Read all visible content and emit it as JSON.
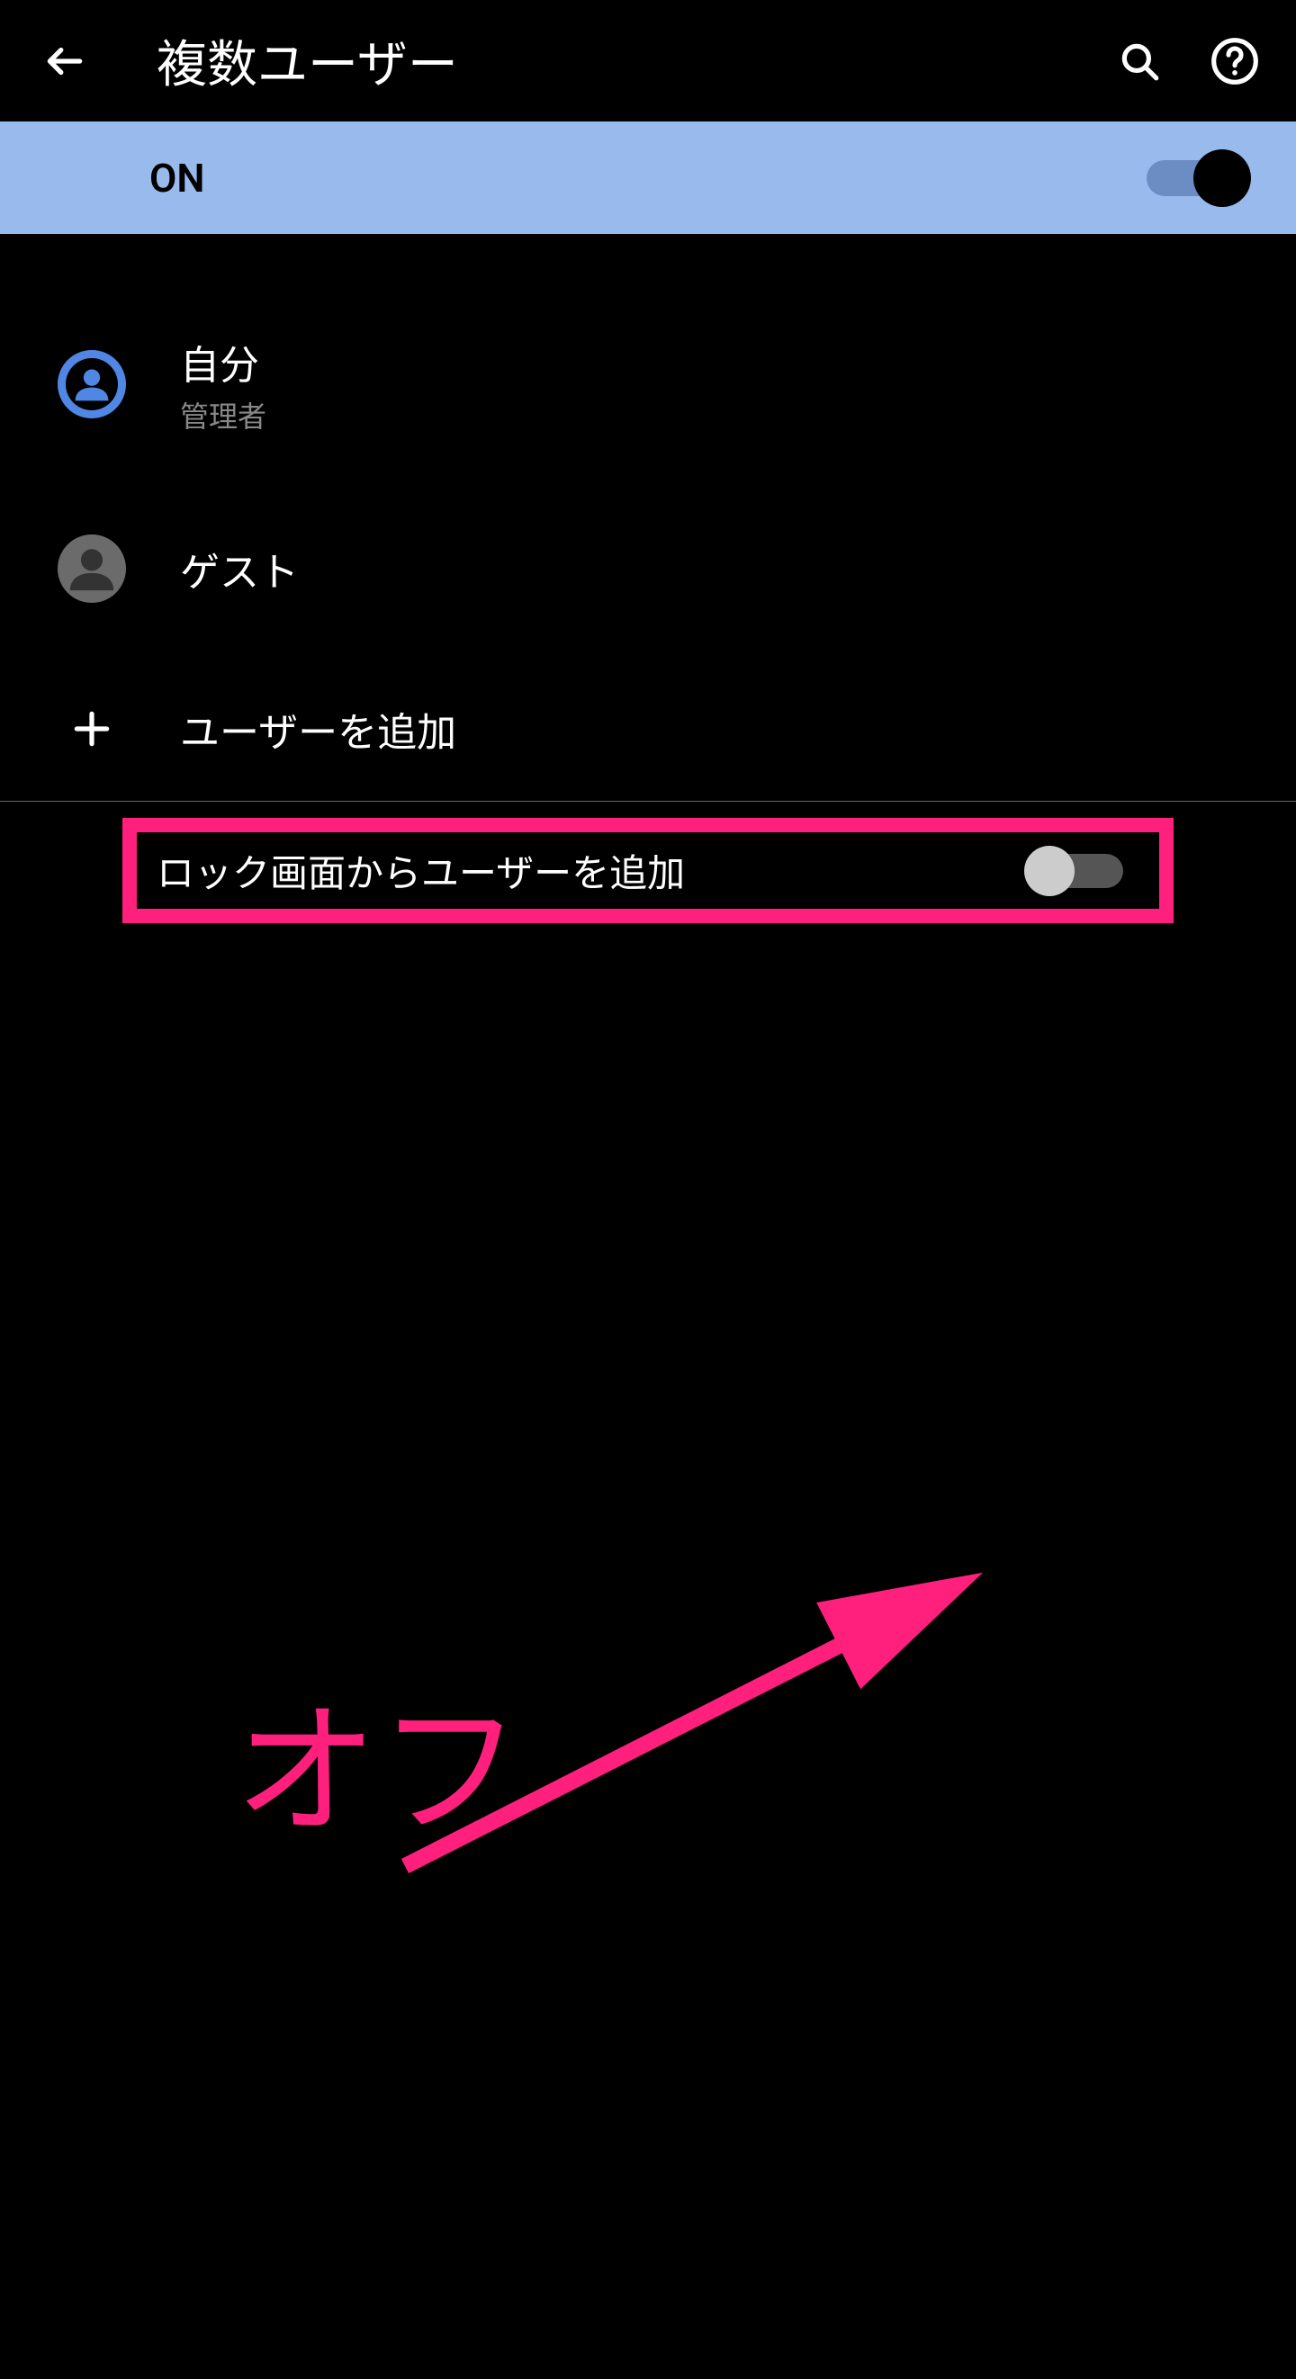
{
  "header": {
    "title": "複数ユーザー"
  },
  "status": {
    "label": "ON",
    "enabled": true
  },
  "users": {
    "self": {
      "name": "自分",
      "role": "管理者"
    },
    "guest": {
      "name": "ゲスト"
    },
    "add_label": "ユーザーを追加"
  },
  "lock_screen": {
    "label": "ロック画面からユーザーを追加",
    "enabled": false
  },
  "annotation": {
    "text": "オフ"
  }
}
